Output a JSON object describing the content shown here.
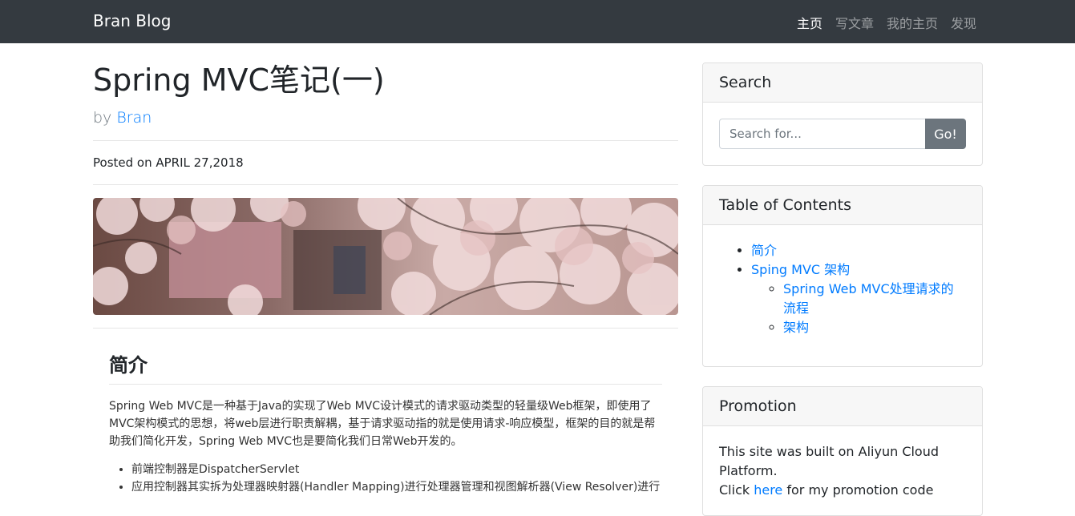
{
  "navbar": {
    "brand": "Bran Blog",
    "links": [
      "主页",
      "写文章",
      "我的主页",
      "发现"
    ]
  },
  "post": {
    "title": "Spring MVC笔记(一)",
    "by_prefix": "by",
    "author": "Bran",
    "posted": "Posted on APRIL 27,2018",
    "section_heading": "简介",
    "intro": "Spring Web MVC是一种基于Java的实现了Web MVC设计模式的请求驱动类型的轻量级Web框架，即使用了MVC架构模式的思想，将web层进行职责解耦，基于请求驱动指的就是使用请求-响应模型，框架的目的就是帮助我们简化开发，Spring Web MVC也是要简化我们日常Web开发的。",
    "bullets": [
      "前端控制器是DispatcherServlet",
      "应用控制器其实拆为处理器映射器(Handler Mapping)进行处理器管理和视图解析器(View Resolver)进行"
    ]
  },
  "sidebar": {
    "search": {
      "title": "Search",
      "placeholder": "Search for...",
      "button": "Go!"
    },
    "toc": {
      "title": "Table of Contents",
      "items": [
        "简介",
        "Sping MVC 架构"
      ],
      "subitems": [
        "Spring Web MVC处理请求的流程",
        "架构"
      ]
    },
    "promotion": {
      "title": "Promotion",
      "text": "This site was built on Aliyun Cloud Platform.",
      "click_prefix": "Click",
      "link": "here",
      "click_suffix": "for my promotion code"
    }
  },
  "colors": {
    "navbar_bg": "#343a40",
    "link": "#007bff",
    "button_bg": "#6c757d"
  }
}
